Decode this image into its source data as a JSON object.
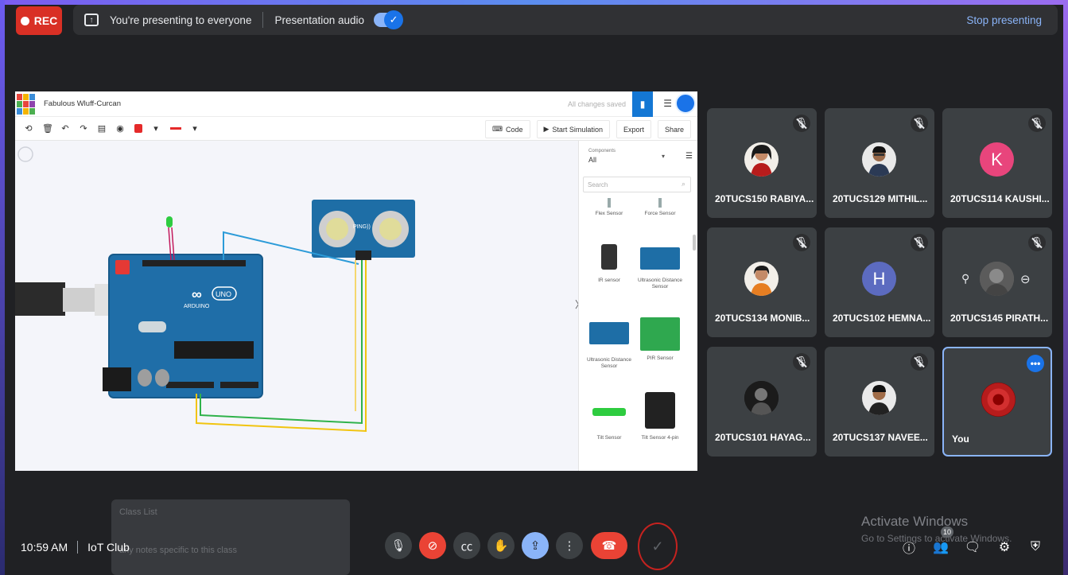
{
  "topbar": {
    "rec_label": "REC",
    "presenting_text": "You're presenting to everyone",
    "audio_label": "Presentation audio",
    "audio_enabled": true,
    "stop_label": "Stop presenting"
  },
  "tinkercad": {
    "project_name": "Fabulous Wluff-Curcan",
    "save_status": "All changes saved",
    "code_label": "Code",
    "simulation_label": "Start Simulation",
    "export_label": "Export",
    "share_label": "Share",
    "components_label": "Components",
    "components_value": "All",
    "search_placeholder": "Search",
    "parts": [
      "Flex Sensor",
      "Force Sensor",
      "IR sensor",
      "Ultrasonic Distance Sensor",
      "Ultrasonic Distance Sensor",
      "PIR Sensor",
      "Tilt Sensor",
      "Tilt Sensor 4-pin"
    ],
    "board_brand": "ARDUINO",
    "board_model": "UNO",
    "sensor_label": "PING))"
  },
  "participants": [
    {
      "name": "20TUCS150 RABIYA...",
      "muted": true,
      "avatar": "photo"
    },
    {
      "name": "20TUCS129 MITHIL...",
      "muted": true,
      "avatar": "photo"
    },
    {
      "name": "20TUCS114 KAUSHI...",
      "muted": true,
      "avatar": "letter",
      "letter": "K",
      "color": "#e8457c"
    },
    {
      "name": "20TUCS134 MONIB...",
      "muted": true,
      "avatar": "photo"
    },
    {
      "name": "20TUCS102 HEMNA...",
      "muted": true,
      "avatar": "letter",
      "letter": "H",
      "color": "#5c6bc0"
    },
    {
      "name": "20TUCS145 PIRATH...",
      "muted": true,
      "avatar": "photo"
    },
    {
      "name": "20TUCS101 HAYAG...",
      "muted": true,
      "avatar": "photo"
    },
    {
      "name": "20TUCS137 NAVEE...",
      "muted": true,
      "avatar": "photo"
    },
    {
      "name": "You",
      "muted": false,
      "avatar": "photo"
    }
  ],
  "bottom": {
    "time": "10:59 AM",
    "meeting_name": "IoT Club",
    "people_count": "10"
  },
  "overlay": {
    "activate_title": "Activate Windows",
    "activate_sub": "Go to Settings to activate Windows.",
    "class_list_title": "Class List",
    "class_list_note": "any notes specific to this class"
  }
}
